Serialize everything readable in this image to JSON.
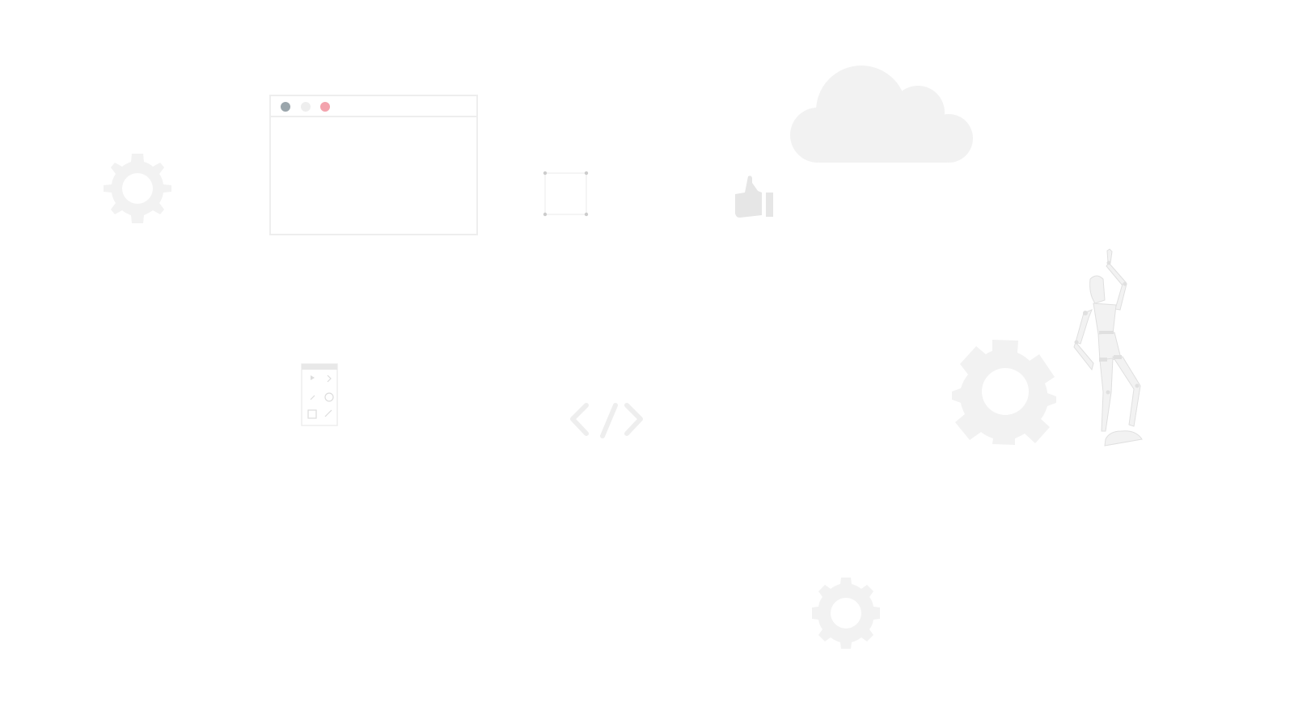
{
  "scene": {
    "background": "#ffffff",
    "illustration_color": "#f2f2f2",
    "illustration_accent": "#e6e6e6",
    "icons": [
      "gear-icon",
      "browser-window-icon",
      "selection-box-icon",
      "thumbs-up-icon",
      "cloud-icon",
      "toolbar-panel-icon",
      "code-brackets-icon",
      "mannequin-figure"
    ]
  },
  "browser_window": {
    "dots": [
      {
        "name": "window-dot-gray",
        "color": "#9aa5ab"
      },
      {
        "name": "window-dot-light",
        "color": "#eeeeee"
      },
      {
        "name": "window-dot-pink",
        "color": "#f3a3ad"
      }
    ]
  }
}
